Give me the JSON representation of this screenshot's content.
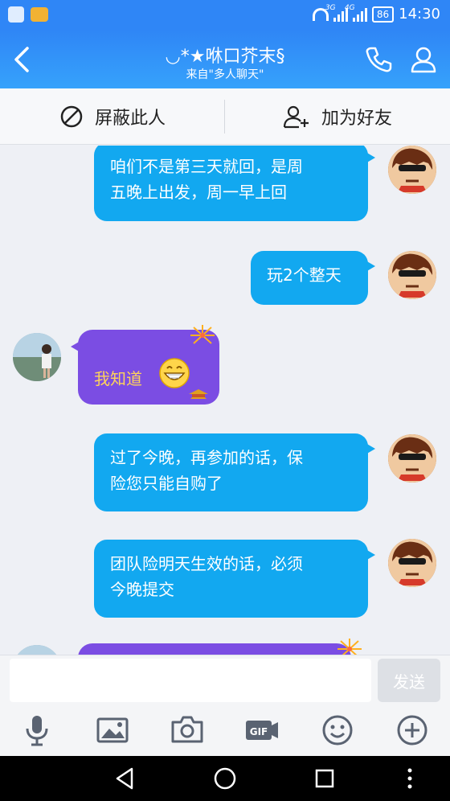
{
  "status_bar": {
    "time": "14:30",
    "battery": "86",
    "net1": "3G",
    "net2": "4G"
  },
  "header": {
    "title": "◡*★咻口芥末§",
    "subtitle": "来自\"多人聊天\""
  },
  "actions": {
    "block": "屏蔽此人",
    "add_friend": "加为好友"
  },
  "messages": [
    {
      "from": "me",
      "lines": [
        "咱们不是第三天就回，是周",
        "五晚上出发，周一早上回"
      ]
    },
    {
      "from": "me",
      "lines": [
        "玩2个整天"
      ]
    },
    {
      "from": "other",
      "lines": [
        "我知道"
      ]
    },
    {
      "from": "me",
      "lines": [
        "过了今晚，再参加的话，保",
        "险您只能自购了"
      ]
    },
    {
      "from": "me",
      "lines": [
        "团队险明天生效的话，必须",
        "今晚提交"
      ]
    }
  ],
  "input": {
    "value": "",
    "placeholder": "",
    "send_label": "发送"
  },
  "toolbar": [
    "microphone-icon",
    "image-icon",
    "camera-icon",
    "gif-icon",
    "emoji-icon",
    "plus-icon"
  ],
  "colors": {
    "header": "#2f86f6",
    "my_bubble": "#12a8f0",
    "their_bubble": "#7b4de3",
    "their_text": "#ffd35a"
  }
}
